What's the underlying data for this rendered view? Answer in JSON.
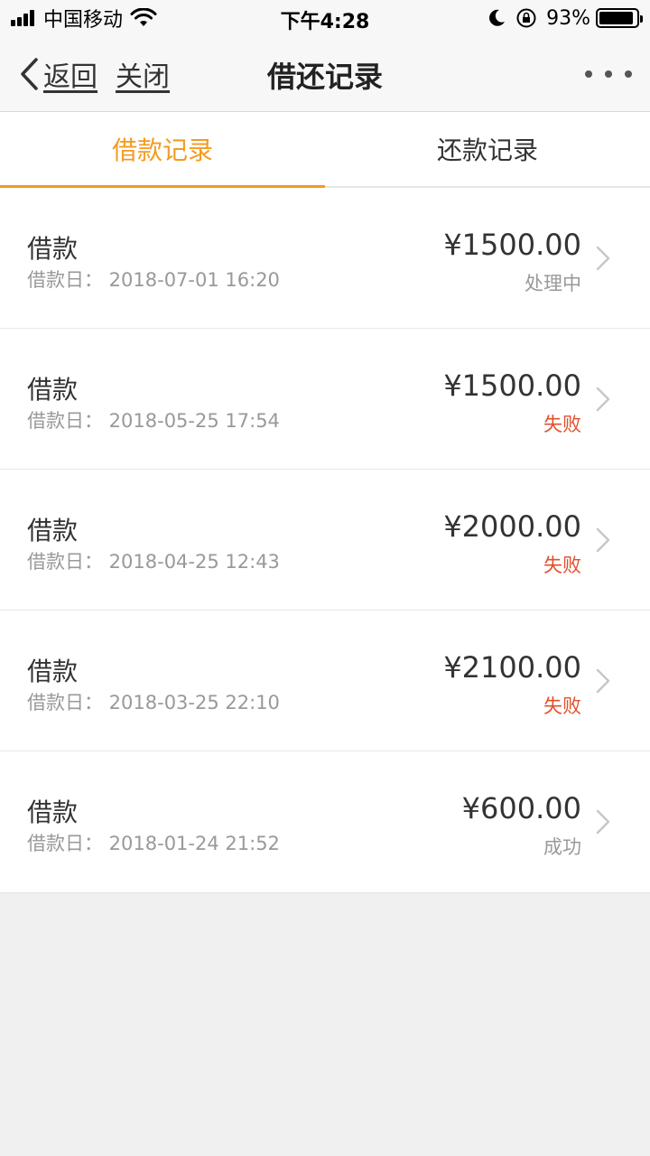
{
  "status_bar": {
    "carrier": "中国移动",
    "time": "下午4:28",
    "battery_percent": "93%",
    "battery_level": 0.93
  },
  "nav": {
    "back_label": "返回",
    "close_label": "关闭",
    "title": "借还记录"
  },
  "tabs": [
    {
      "label": "借款记录",
      "active": true
    },
    {
      "label": "还款记录",
      "active": false
    }
  ],
  "colors": {
    "accent": "#f39b22",
    "failed": "#e0502c",
    "muted": "#999999"
  },
  "records": [
    {
      "title": "借款",
      "date": "借款日：  2018-07-01 16:20",
      "amount": "¥1500.00",
      "status": "处理中",
      "status_type": "processing"
    },
    {
      "title": "借款",
      "date": "借款日：  2018-05-25 17:54",
      "amount": "¥1500.00",
      "status": "失败",
      "status_type": "failed"
    },
    {
      "title": "借款",
      "date": "借款日：  2018-04-25 12:43",
      "amount": "¥2000.00",
      "status": "失败",
      "status_type": "failed"
    },
    {
      "title": "借款",
      "date": "借款日：  2018-03-25 22:10",
      "amount": "¥2100.00",
      "status": "失败",
      "status_type": "failed"
    },
    {
      "title": "借款",
      "date": "借款日：  2018-01-24 21:52",
      "amount": "¥600.00",
      "status": "成功",
      "status_type": "success"
    }
  ]
}
